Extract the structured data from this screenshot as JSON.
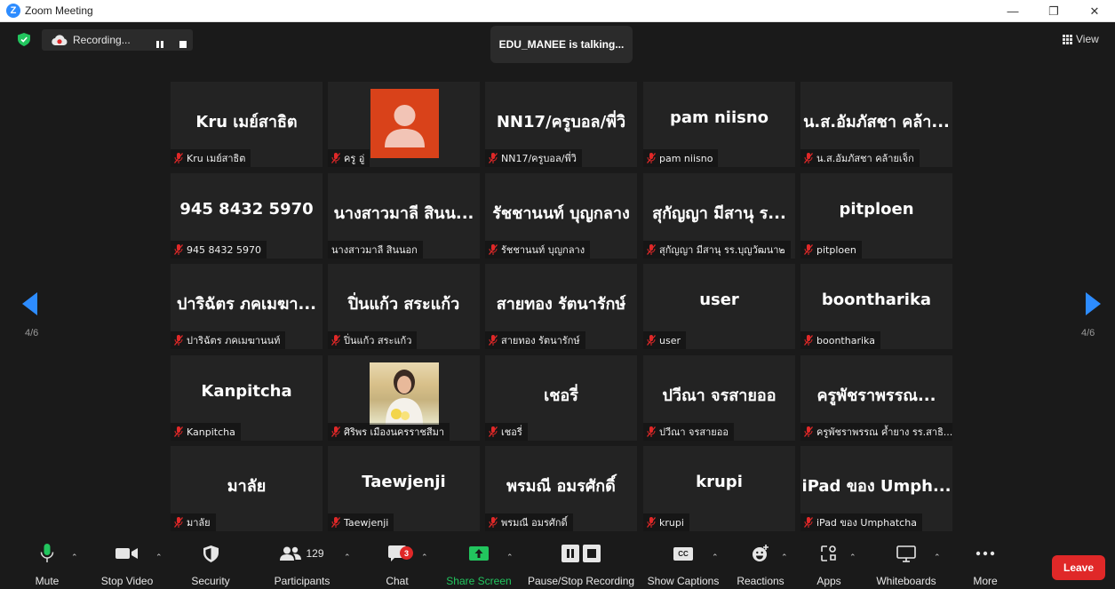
{
  "window": {
    "title": "Zoom Meeting",
    "logo_letter": "Z"
  },
  "top": {
    "recording_label": "Recording...",
    "talking": "EDU_MANEE is talking...",
    "view_label": "View"
  },
  "pager": {
    "left": "4/6",
    "right": "4/6"
  },
  "tiles": [
    {
      "big": "Kru เมย์สาธิต",
      "cap": "Kru เมย์สาธิต",
      "muted": true
    },
    {
      "big": "",
      "cap": "ครู อู่",
      "muted": true,
      "avatar": true
    },
    {
      "big": "NN17/ครูบอล/พี่วิ",
      "cap": "NN17/ครูบอล/พี่วิ",
      "muted": true
    },
    {
      "big": "pam niisno",
      "cap": "pam niisno",
      "muted": true
    },
    {
      "big": "น.ส.อัมภัสชา คล้า...",
      "cap": "น.ส.อัมภัสชา คล้ายเจ็ก",
      "muted": true
    },
    {
      "big": "945 8432 5970",
      "cap": "945 8432 5970",
      "muted": true
    },
    {
      "big": "นางสาวมาลี สินน...",
      "cap": "นางสาวมาลี สินนอก",
      "muted": false
    },
    {
      "big": "รัชชานนท์ บุญกลาง",
      "cap": "รัชชานนท์ บุญกลาง",
      "muted": true
    },
    {
      "big": "สุกัญญา มีสานุ ร...",
      "cap": "สุกัญญา มีสานุ รร.บุญวัฒนา๒",
      "muted": true
    },
    {
      "big": "pitploen",
      "cap": "pitploen",
      "muted": true
    },
    {
      "big": "ปาริฉัตร ภคเมฆา...",
      "cap": "ปาริฉัตร ภคเมฆานนท์",
      "muted": true
    },
    {
      "big": "ปิ่นแก้ว สระแก้ว",
      "cap": "ปิ่นแก้ว สระแก้ว",
      "muted": true
    },
    {
      "big": "สายทอง รัตนารักษ์",
      "cap": "สายทอง รัตนารักษ์",
      "muted": true
    },
    {
      "big": "user",
      "cap": "user",
      "muted": true
    },
    {
      "big": "boontharika",
      "cap": "boontharika",
      "muted": true
    },
    {
      "big": "Kanpitcha",
      "cap": "Kanpitcha",
      "muted": true
    },
    {
      "big": "",
      "cap": "ศิริพร เมืองนครราชสีมา",
      "muted": true,
      "photo": true
    },
    {
      "big": "เชอรี่",
      "cap": "เชอรี่",
      "muted": true
    },
    {
      "big": "ปวีณา จรสายออ",
      "cap": "ปวีณา จรสายออ",
      "muted": true
    },
    {
      "big": "ครูพัชราพรรณ...",
      "cap": "ครูพัชราพรรณ ค้ำยาง รร.สาธิ...",
      "muted": true
    },
    {
      "big": "มาลัย",
      "cap": "มาลัย",
      "muted": true
    },
    {
      "big": "Taewjenji",
      "cap": "Taewjenji",
      "muted": true
    },
    {
      "big": "พรมณี อมรศักดิ์",
      "cap": "พรมณี อมรศักดิ์",
      "muted": true
    },
    {
      "big": "krupi",
      "cap": "krupi",
      "muted": true
    },
    {
      "big": "iPad ของ Umph...",
      "cap": "iPad ของ Umphatcha",
      "muted": true
    }
  ],
  "toolbar": {
    "mute": "Mute",
    "stop_video": "Stop Video",
    "security": "Security",
    "participants": "Participants",
    "participants_count": "129",
    "chat": "Chat",
    "chat_badge": "3",
    "share_screen": "Share Screen",
    "pause_stop_recording": "Pause/Stop Recording",
    "show_captions": "Show Captions",
    "captions_icon_text": "CC",
    "reactions": "Reactions",
    "apps": "Apps",
    "whiteboards": "Whiteboards",
    "more": "More",
    "leave": "Leave"
  },
  "colors": {
    "accent": "#2d8cff",
    "mute_red": "#e02828",
    "share_green": "#22c55e",
    "avatar_bg": "#d9421a"
  }
}
